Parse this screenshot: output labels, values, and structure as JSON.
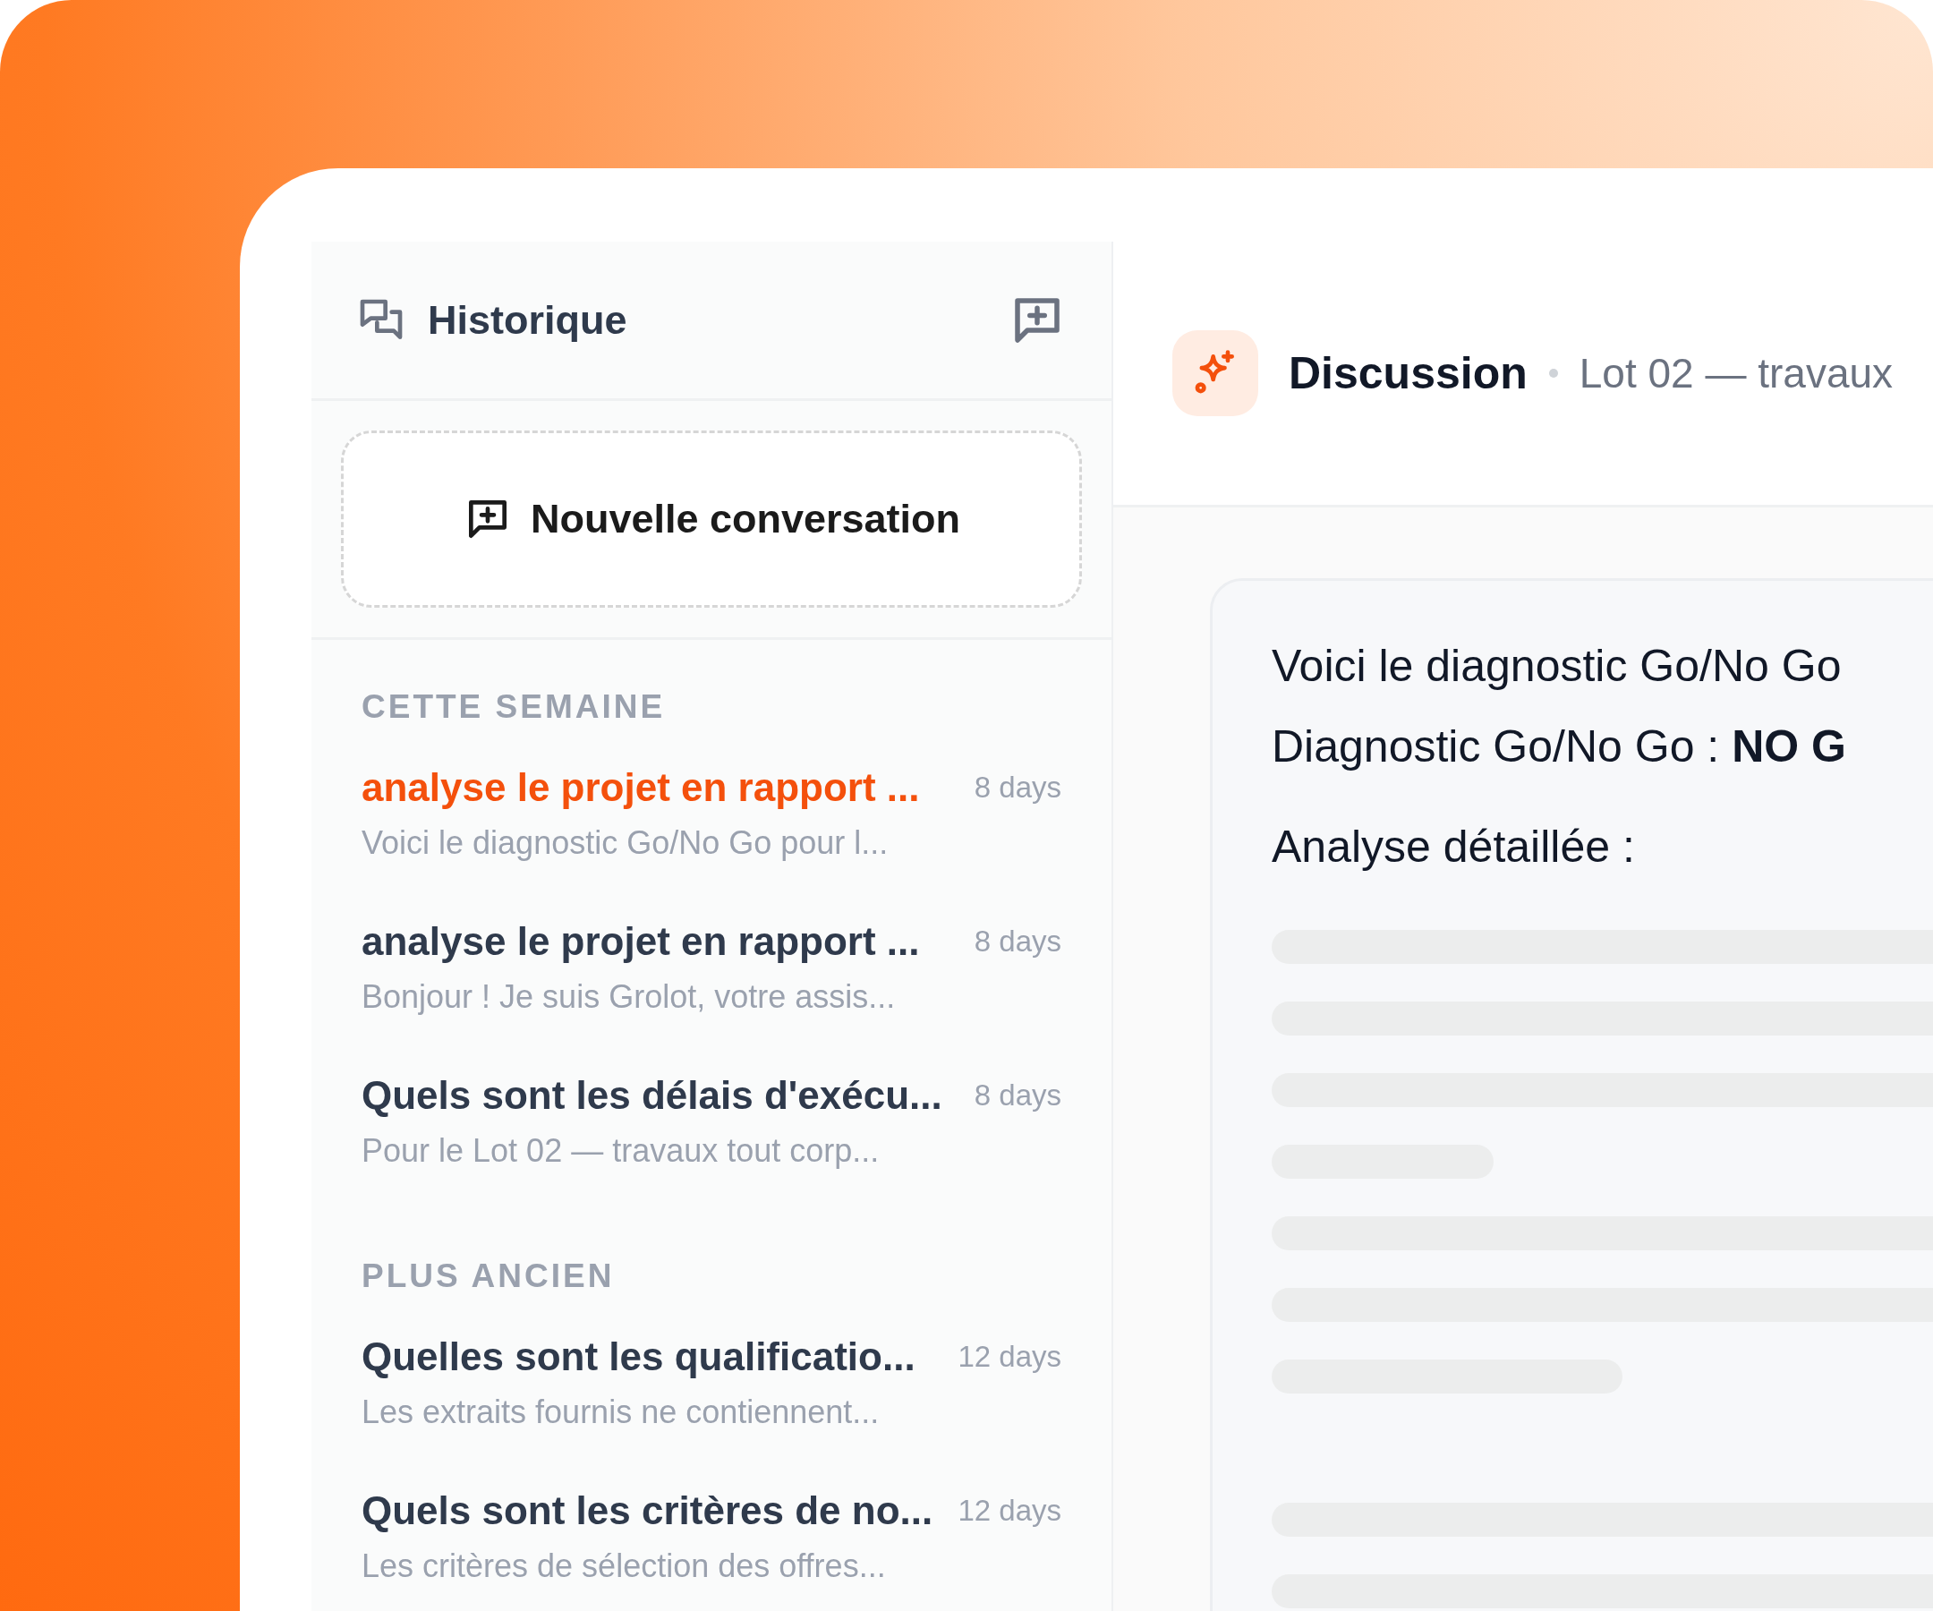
{
  "sidebar": {
    "title": "Historique",
    "new_button": "Nouvelle conversation",
    "groups": [
      {
        "heading": "CETTE SEMAINE",
        "items": [
          {
            "title": "analyse le projet en rapport ...",
            "preview": "Voici le diagnostic Go/No Go pour l...",
            "age": "8 days",
            "selected": true
          },
          {
            "title": "analyse le projet en rapport ...",
            "preview": "Bonjour ! Je suis Grolot, votre assis...",
            "age": "8 days",
            "selected": false
          },
          {
            "title": "Quels sont les délais d'exécu...",
            "preview": "Pour le Lot 02 — travaux tout corp...",
            "age": "8 days",
            "selected": false
          }
        ]
      },
      {
        "heading": "PLUS ANCIEN",
        "items": [
          {
            "title": "Quelles sont les qualificatio...",
            "preview": "Les extraits fournis ne contiennent...",
            "age": "12 days",
            "selected": false
          },
          {
            "title": "Quels sont les critères de no...",
            "preview": "Les critères de sélection des offres...",
            "age": "12 days",
            "selected": false
          }
        ]
      }
    ]
  },
  "conversation": {
    "title": "Discussion",
    "subtitle": "Lot 02 — travaux",
    "message": {
      "lines": [
        "Voici le diagnostic Go/No Go",
        "Diagnostic Go/No Go : **NO G**",
        "Analyse détaillée :"
      ]
    }
  }
}
